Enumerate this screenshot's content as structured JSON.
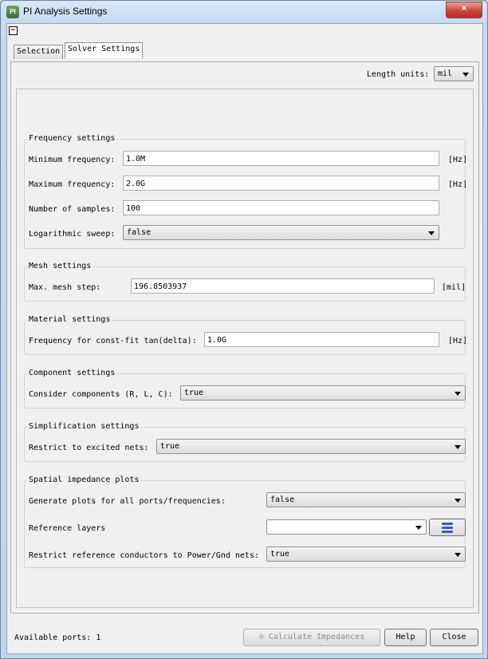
{
  "window": {
    "title": "PI Analysis Settings",
    "icon_text": "PI",
    "close_icon": "×"
  },
  "tabs": [
    {
      "label": "Selection"
    },
    {
      "label": "Solver Settings"
    }
  ],
  "length_units": {
    "label": "Length units:",
    "value": "mil"
  },
  "frequency_settings": {
    "title": "Frequency settings",
    "min_label": "Minimum frequency:",
    "min_value": "1.0M",
    "min_unit": "[Hz]",
    "max_label": "Maximum frequency:",
    "max_value": "2.0G",
    "max_unit": "[Hz]",
    "samples_label": "Number of samples:",
    "samples_value": "100",
    "log_label": "Logarithmic sweep:",
    "log_value": "false"
  },
  "mesh_settings": {
    "title": "Mesh settings",
    "step_label": "Max. mesh step:",
    "step_value": "196.8503937",
    "step_unit": "[mil]"
  },
  "material_settings": {
    "title": "Material settings",
    "freq_label": "Frequency for const-fit tan(delta):",
    "freq_value": "1.0G",
    "freq_unit": "[Hz]"
  },
  "component_settings": {
    "title": "Component settings",
    "consider_label": "Consider components (R, L, C):",
    "consider_value": "true"
  },
  "simplification_settings": {
    "title": "Simplification settings",
    "restrict_label": "Restrict to excited nets:",
    "restrict_value": "true"
  },
  "spatial_plots": {
    "title": "Spatial impedance plots",
    "generate_label": "Generate plots for all ports/frequencies:",
    "generate_value": "false",
    "ref_layers_label": "Reference layers",
    "ref_layers_value": "",
    "restrict_label": "Restrict reference conductors to Power/Gnd nets:",
    "restrict_value": "true"
  },
  "footer": {
    "available_ports": "Available ports: 1",
    "calculate_label": "Calculate Impedances",
    "help_label": "Help",
    "close_label": "Close"
  }
}
